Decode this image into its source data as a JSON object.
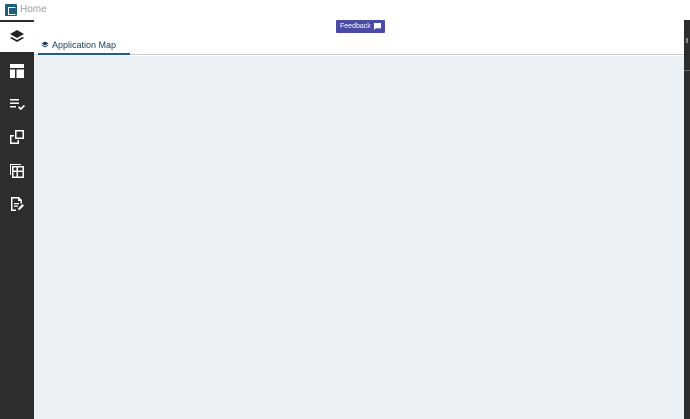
{
  "window": {
    "title": "Home"
  },
  "sidebar": {
    "items": [
      {
        "icon": "layers-icon",
        "active": true
      },
      {
        "icon": "dashboard-layout-icon",
        "active": false
      },
      {
        "icon": "checklist-icon",
        "active": false
      },
      {
        "icon": "copy-pages-icon",
        "active": false
      },
      {
        "icon": "grid-table-icon",
        "active": false
      },
      {
        "icon": "document-edit-icon",
        "active": false
      }
    ]
  },
  "header": {
    "feedback_label": "Feedback",
    "tabs": [
      {
        "label": "Application Map",
        "icon": "layers-icon"
      }
    ]
  },
  "colors": {
    "sidebar_bg": "#2d2d2d",
    "feedback_bg": "#4b4aa4",
    "tab_accent": "#1e5f8e",
    "content_bg": "#ecf0f3"
  }
}
